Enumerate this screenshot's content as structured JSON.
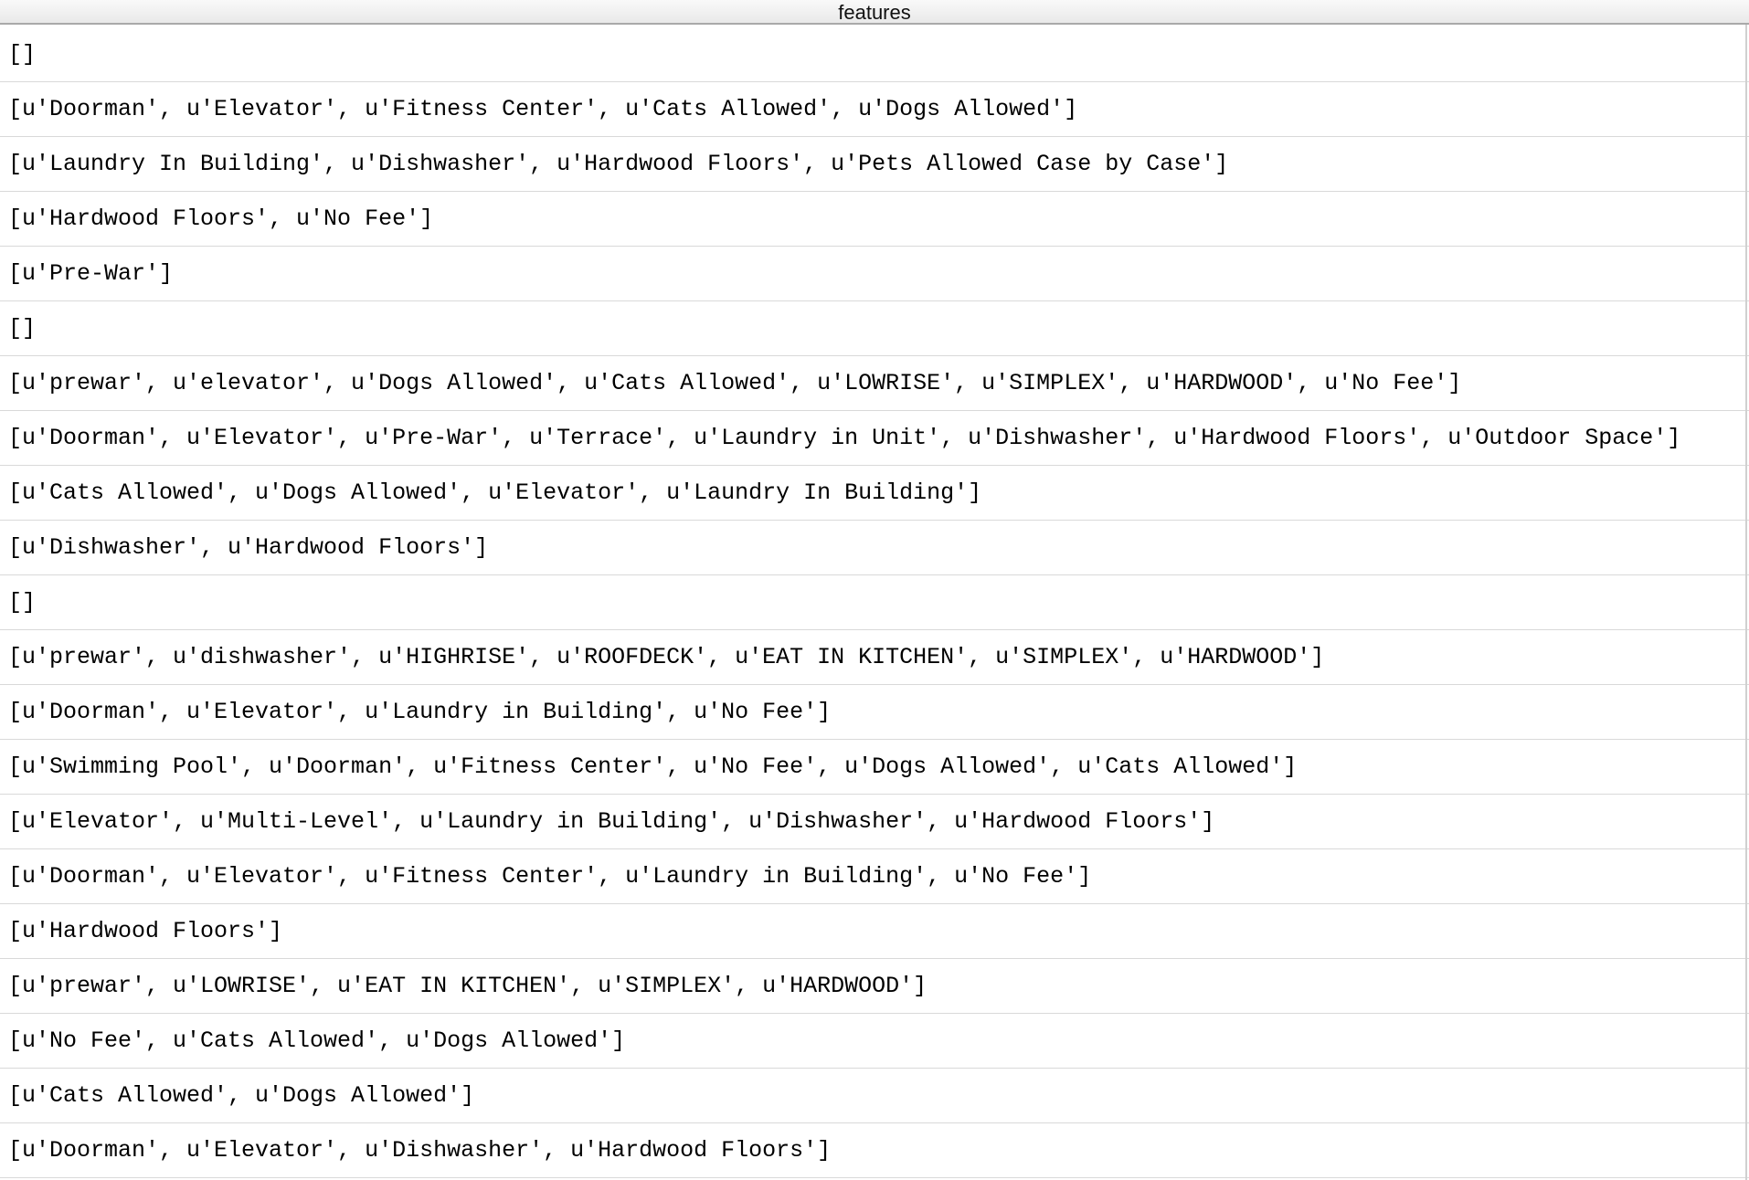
{
  "table": {
    "column_header": "features",
    "rows": [
      "[]",
      "[u'Doorman', u'Elevator', u'Fitness Center', u'Cats Allowed', u'Dogs Allowed']",
      "[u'Laundry In Building', u'Dishwasher', u'Hardwood Floors', u'Pets Allowed Case by Case']",
      "[u'Hardwood Floors', u'No Fee']",
      "[u'Pre-War']",
      "[]",
      "[u'prewar', u'elevator', u'Dogs Allowed', u'Cats Allowed', u'LOWRISE', u'SIMPLEX', u'HARDWOOD', u'No Fee']",
      "[u'Doorman', u'Elevator', u'Pre-War', u'Terrace', u'Laundry in Unit', u'Dishwasher', u'Hardwood Floors', u'Outdoor Space']",
      "[u'Cats Allowed', u'Dogs Allowed', u'Elevator', u'Laundry In Building']",
      "[u'Dishwasher', u'Hardwood Floors']",
      "[]",
      "[u'prewar', u'dishwasher', u'HIGHRISE', u'ROOFDECK', u'EAT IN KITCHEN', u'SIMPLEX', u'HARDWOOD']",
      "[u'Doorman', u'Elevator', u'Laundry in Building', u'No Fee']",
      "[u'Swimming Pool', u'Doorman', u'Fitness Center', u'No Fee', u'Dogs Allowed', u'Cats Allowed']",
      "[u'Elevator', u'Multi-Level', u'Laundry in Building', u'Dishwasher', u'Hardwood Floors']",
      "[u'Doorman', u'Elevator', u'Fitness Center', u'Laundry in Building', u'No Fee']",
      "[u'Hardwood Floors']",
      "[u'prewar', u'LOWRISE', u'EAT IN KITCHEN', u'SIMPLEX', u'HARDWOOD']",
      "[u'No Fee', u'Cats Allowed', u'Dogs Allowed']",
      "[u'Cats Allowed', u'Dogs Allowed']",
      "[u'Doorman', u'Elevator', u'Dishwasher', u'Hardwood Floors']"
    ]
  }
}
